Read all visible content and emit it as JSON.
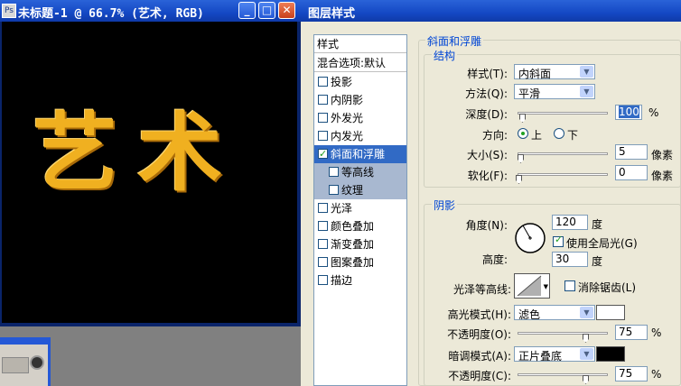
{
  "document": {
    "title": "未标题-1 @ 66.7% (艺术, RGB)",
    "canvas_text": "艺术",
    "controls": {
      "minimize": "_",
      "maximize": "□",
      "close": "✕"
    }
  },
  "dialog": {
    "title": "图层样式",
    "styles_panel": {
      "header": "样式",
      "blend_options": "混合选项:默认",
      "items": [
        {
          "label": "投影",
          "checked": false
        },
        {
          "label": "内阴影",
          "checked": false
        },
        {
          "label": "外发光",
          "checked": false
        },
        {
          "label": "内发光",
          "checked": false
        },
        {
          "label": "斜面和浮雕",
          "checked": true,
          "selected": true
        },
        {
          "label": "等高线",
          "checked": false,
          "sub": true
        },
        {
          "label": "纹理",
          "checked": false,
          "sub": true
        },
        {
          "label": "光泽",
          "checked": false
        },
        {
          "label": "颜色叠加",
          "checked": false
        },
        {
          "label": "渐变叠加",
          "checked": false
        },
        {
          "label": "图案叠加",
          "checked": false
        },
        {
          "label": "描边",
          "checked": false
        }
      ]
    },
    "bevel": {
      "section_title": "斜面和浮雕",
      "structure": {
        "title": "结构",
        "style_label": "样式(T):",
        "style_value": "内斜面",
        "technique_label": "方法(Q):",
        "technique_value": "平滑",
        "depth_label": "深度(D):",
        "depth_value": "100",
        "depth_unit": "%",
        "direction_label": "方向:",
        "direction_up": "上",
        "direction_down": "下",
        "direction_selected": "up",
        "size_label": "大小(S):",
        "size_value": "5",
        "size_unit": "像素",
        "soften_label": "软化(F):",
        "soften_value": "0",
        "soften_unit": "像素"
      },
      "shading": {
        "title": "阴影",
        "angle_label": "角度(N):",
        "angle_value": "120",
        "angle_unit": "度",
        "global_light_label": "使用全局光(G)",
        "global_light_checked": true,
        "altitude_label": "高度:",
        "altitude_value": "30",
        "altitude_unit": "度",
        "gloss_contour_label": "光泽等高线:",
        "antialias_label": "消除锯齿(L)",
        "antialias_checked": false,
        "highlight_mode_label": "高光模式(H):",
        "highlight_mode_value": "滤色",
        "highlight_color": "#ffffff",
        "highlight_opacity_label": "不透明度(O):",
        "highlight_opacity_value": "75",
        "shadow_mode_label": "暗调模式(A):",
        "shadow_mode_value": "正片叠底",
        "shadow_color": "#000000",
        "shadow_opacity_label": "不透明度(C):",
        "shadow_opacity_value": "75",
        "percent_unit": "%"
      }
    }
  },
  "colors": {
    "titlebar": "#1448c4",
    "selection": "#316ac5",
    "art_gold": "#f0b020"
  }
}
